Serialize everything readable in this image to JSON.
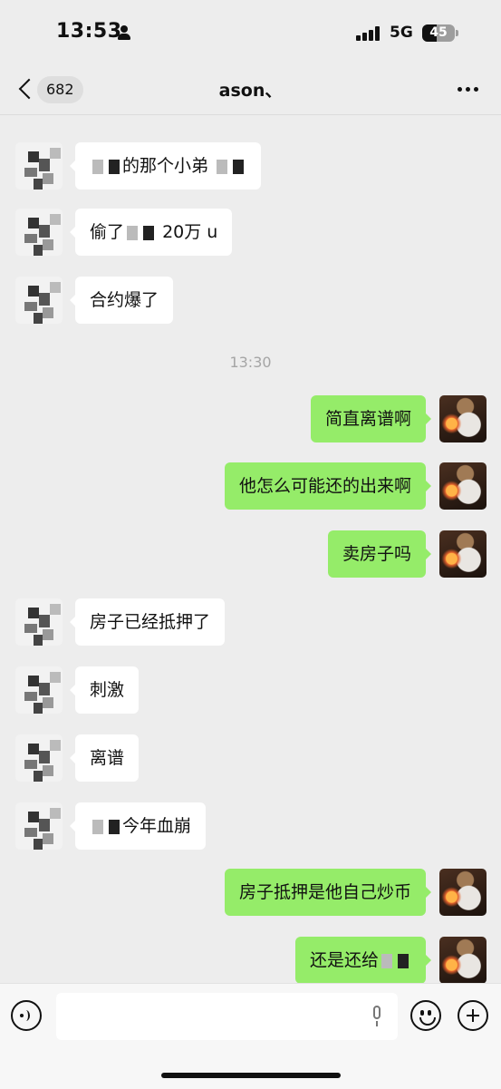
{
  "status_bar": {
    "time": "13:53",
    "network": "5G",
    "battery": "45",
    "battery_level_percent": 45
  },
  "nav": {
    "back_count": "682",
    "title": "ason、"
  },
  "messages": [
    {
      "side": "left",
      "avatar": "mosaic",
      "text": "的那个小弟"
    },
    {
      "side": "left",
      "avatar": "mosaic",
      "text_before": "偷了",
      "text_after": "20万 u"
    },
    {
      "side": "left",
      "avatar": "mosaic",
      "text": "合约爆了"
    },
    {
      "side": "right",
      "avatar": "cat",
      "text": "简直离谱啊"
    },
    {
      "side": "right",
      "avatar": "cat",
      "text": "他怎么可能还的出来啊"
    },
    {
      "side": "right",
      "avatar": "cat",
      "text": "卖房子吗"
    },
    {
      "side": "left",
      "avatar": "mosaic",
      "text": "房子已经抵押了"
    },
    {
      "side": "left",
      "avatar": "mosaic",
      "text": "刺激"
    },
    {
      "side": "left",
      "avatar": "mosaic",
      "text": "离谱"
    },
    {
      "side": "left",
      "avatar": "mosaic",
      "text": "今年血崩"
    },
    {
      "side": "right",
      "avatar": "cat",
      "text": "房子抵押是他自己炒币"
    },
    {
      "side": "right",
      "avatar": "cat",
      "text": "还是还给"
    }
  ],
  "timestamp": "13:30",
  "input": {
    "placeholder": ""
  }
}
